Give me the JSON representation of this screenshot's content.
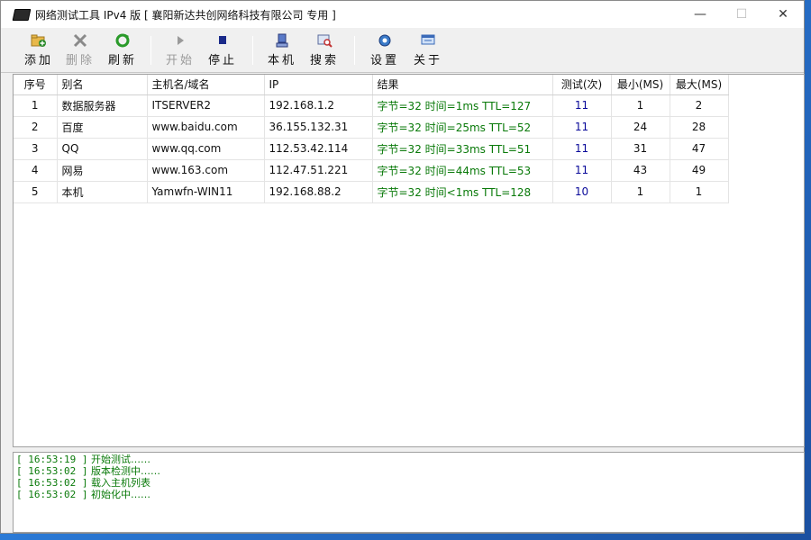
{
  "titlebar": {
    "title": "网络测试工具 IPv4 版 [ 襄阳新达共创网络科技有限公司 专用 ]",
    "minimize": "—",
    "maximize": "☐",
    "close": "✕"
  },
  "toolbar": {
    "add": "添加",
    "delete": "删除",
    "refresh": "刷新",
    "start": "开始",
    "stop": "停止",
    "local": "本机",
    "search": "搜索",
    "settings": "设置",
    "about": "关于"
  },
  "table": {
    "headers": {
      "seq": "序号",
      "alias": "别名",
      "host": "主机名/域名",
      "ip": "IP",
      "result": "结果",
      "tests": "测试(次)",
      "min": "最小(MS)",
      "max": "最大(MS)"
    },
    "rows": [
      {
        "seq": "1",
        "alias": "数据服务器",
        "host": "ITSERVER2",
        "ip": "192.168.1.2",
        "result": "字节=32 时间=1ms TTL=127",
        "tests": "11",
        "min": "1",
        "max": "2"
      },
      {
        "seq": "2",
        "alias": "百度",
        "host": "www.baidu.com",
        "ip": "36.155.132.31",
        "result": "字节=32 时间=25ms TTL=52",
        "tests": "11",
        "min": "24",
        "max": "28"
      },
      {
        "seq": "3",
        "alias": "QQ",
        "host": "www.qq.com",
        "ip": "112.53.42.114",
        "result": "字节=32 时间=33ms TTL=51",
        "tests": "11",
        "min": "31",
        "max": "47"
      },
      {
        "seq": "4",
        "alias": "网易",
        "host": "www.163.com",
        "ip": "112.47.51.221",
        "result": "字节=32 时间=44ms TTL=53",
        "tests": "11",
        "min": "43",
        "max": "49"
      },
      {
        "seq": "5",
        "alias": "本机",
        "host": "Yamwfn-WIN11",
        "ip": "192.168.88.2",
        "result": "字节=32 时间<1ms TTL=128",
        "tests": "10",
        "min": "1",
        "max": "1"
      }
    ]
  },
  "log": [
    {
      "time": "[ 16:53:19 ]",
      "msg": "开始测试……"
    },
    {
      "time": "[ 16:53:02 ]",
      "msg": "版本检测中……"
    },
    {
      "time": "[ 16:53:02 ]",
      "msg": "载入主机列表"
    },
    {
      "time": "[ 16:53:02 ]",
      "msg": "初始化中……"
    }
  ]
}
